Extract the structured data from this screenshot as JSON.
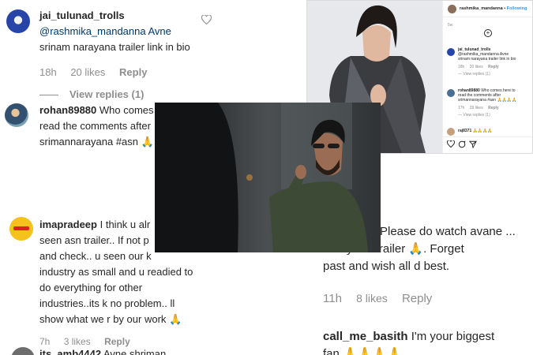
{
  "left_comments": [
    {
      "user": "jai_tulunad_trolls",
      "lines": [
        "@rashmika_mandanna Avne",
        "srinam narayana trailer link in bio"
      ],
      "time": "18h",
      "likes": "20 likes",
      "reply": "Reply",
      "view_replies": "View replies (1)"
    },
    {
      "user": "rohan89880",
      "lines": [
        "Who comes",
        "read the comments after",
        "srimannarayana #asn 🙏🙏"
      ]
    },
    {
      "user": "imapradeep",
      "lines": [
        "I think u alr",
        "seen asn trailer.. If not p",
        "and check.. u seen our k",
        "industry as small and u readied to",
        "do everything for other",
        "industries..its k no problem.. ll",
        "show what we r by our work 🙏"
      ],
      "time": "7h",
      "likes": "3 likes",
      "reply": "Reply"
    },
    {
      "user": "its_amb4442",
      "lines": [
        "Avne shriman"
      ]
    }
  ],
  "right_comment": {
    "lines": [
      "Please do watch avane ...",
      "narayana trailer 🙏. Forget",
      "past and wish all d best."
    ],
    "time": "11h",
    "likes": "8 likes",
    "reply": "Reply",
    "next_user": "call_me_basith",
    "next_text": "I'm your biggest",
    "next_tail": "fan 🙏🙏🙏🙏"
  },
  "post": {
    "header_user": "rashmika_mandanna",
    "follow": "Following",
    "caption_time": "5w",
    "comments": [
      {
        "user": "jai_tulunad_trolls",
        "lines": [
          "@rashmika_mandanna Avne",
          "srinam narayana trailer link in bio"
        ],
        "time": "18h",
        "likes": "20 likes",
        "reply": "Reply",
        "view_replies": "View replies (1)"
      },
      {
        "user": "rohan89880",
        "lines": [
          "Who comes here to",
          "read the comments after",
          "srimannarayana #asn 🙏🙏🙏🙏"
        ],
        "time": "17h",
        "likes": "39 likes",
        "reply": "Reply",
        "view_replies": "View replies (1)"
      },
      {
        "user": "raj8371",
        "lines": [
          "🙏🙏🙏🙏"
        ]
      }
    ]
  },
  "colors": {
    "text": "#262626",
    "muted": "#8e8e8e",
    "link": "#00376b"
  }
}
